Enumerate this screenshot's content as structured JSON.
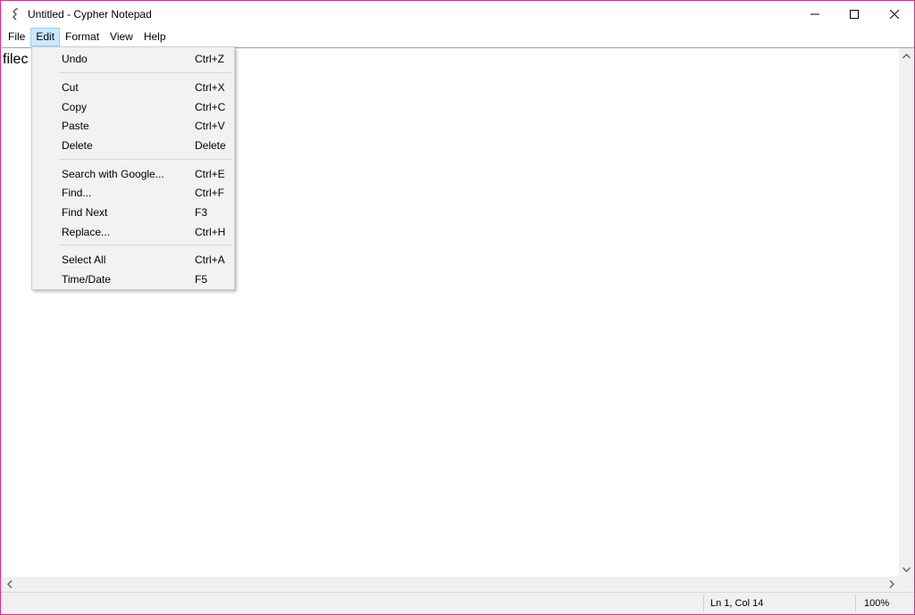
{
  "window": {
    "title": "Untitled - Cypher Notepad",
    "border_color": "#c03a7f"
  },
  "menubar": {
    "items": [
      {
        "label": "File"
      },
      {
        "label": "Edit",
        "active": true
      },
      {
        "label": "Format"
      },
      {
        "label": "View"
      },
      {
        "label": "Help"
      }
    ]
  },
  "editor": {
    "content": "filec"
  },
  "edit_menu": {
    "items": [
      {
        "label": "Undo",
        "shortcut": "Ctrl+Z"
      },
      {
        "label": "Cut",
        "shortcut": "Ctrl+X"
      },
      {
        "label": "Copy",
        "shortcut": "Ctrl+C"
      },
      {
        "label": "Paste",
        "shortcut": "Ctrl+V"
      },
      {
        "label": "Delete",
        "shortcut": "Delete"
      },
      {
        "label": "Search with Google...",
        "shortcut": "Ctrl+E"
      },
      {
        "label": "Find...",
        "shortcut": "Ctrl+F"
      },
      {
        "label": "Find Next",
        "shortcut": "F3"
      },
      {
        "label": "Replace...",
        "shortcut": "Ctrl+H"
      },
      {
        "label": "Select All",
        "shortcut": "Ctrl+A"
      },
      {
        "label": "Time/Date",
        "shortcut": "F5"
      }
    ]
  },
  "statusbar": {
    "position": "Ln 1, Col 14",
    "zoom": "100%"
  },
  "colors": {
    "menu_active_bg": "#cce8ff",
    "dropdown_bg": "#f2f2f2",
    "accent": "#c03a7f"
  }
}
